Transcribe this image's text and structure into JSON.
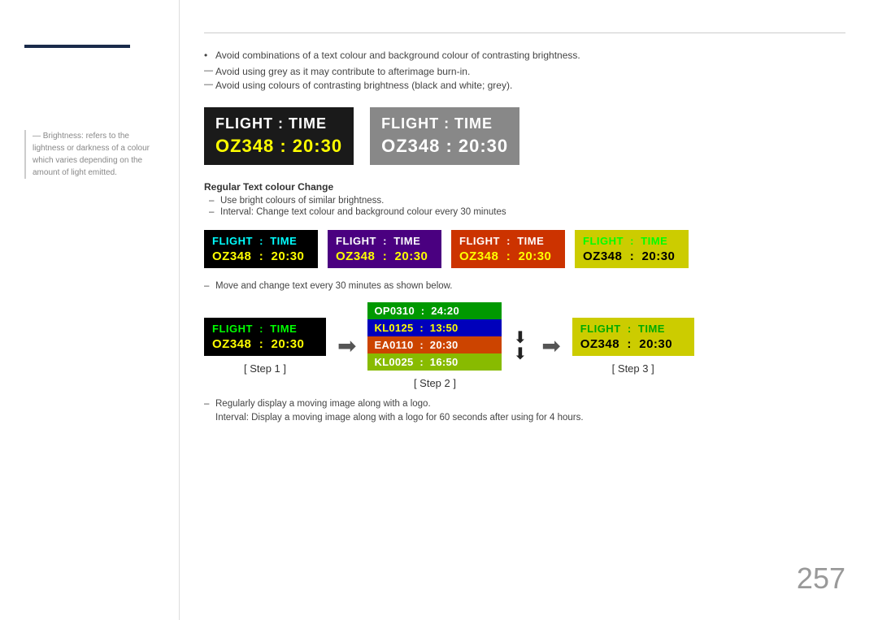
{
  "sidebar": {
    "note_label": "— Brightness: refers to the lightness or darkness of a colour which varies depending on the amount of light emitted."
  },
  "content": {
    "bullet1": "Avoid combinations of a text colour and background colour of contrasting brightness.",
    "dash1": "Avoid using grey as it may contribute to afterimage burn-in.",
    "dash2": "Avoid using colours of contrasting brightness (black and white; grey).",
    "main_box1": {
      "header": "FLIGHT  :  TIME",
      "data": "OZ348  :  20:30"
    },
    "main_box2": {
      "header": "FLIGHT  :  TIME",
      "data": "OZ348  :  20:30"
    },
    "section_title": "Regular Text colour Change",
    "sub1": "Use bright colours of similar brightness.",
    "sub2": "Interval: Change text colour and background colour every 30 minutes",
    "variants": [
      {
        "header": "FLIGHT  :  TIME",
        "data": "OZ348  :  20:30",
        "bg": "black",
        "hc": "cyan",
        "dc": "yellow"
      },
      {
        "header": "FLIGHT  :  TIME",
        "data": "OZ348  :  20:30",
        "bg": "purple",
        "hc": "white",
        "dc": "yellow"
      },
      {
        "header": "FLIGHT  :  TIME",
        "data": "OZ348  :  20:30",
        "bg": "orange-dark",
        "hc": "white",
        "dc": "yellow"
      },
      {
        "header": "FLIGHT  :  TIME",
        "data": "OZ348  :  20:30",
        "bg": "yellow-bg",
        "hc": "green",
        "dc": "black"
      }
    ],
    "steps_dash": "Move and change text every 30 minutes as shown below.",
    "step1": {
      "label": "[ Step 1 ]",
      "box": {
        "header": "FLIGHT  :  TIME",
        "data": "OZ348  :  20:30"
      }
    },
    "step2": {
      "label": "[ Step 2 ]",
      "rows": [
        {
          "code": "OP0310",
          "time": "24:20",
          "bg": "green-bg",
          "tc": "white"
        },
        {
          "code": "KL0125",
          "time": "13:50",
          "bg": "blue-bg",
          "tc": "yellow"
        },
        {
          "code": "EA0110",
          "time": "20:30",
          "bg": "orange-bg",
          "tc": "white"
        },
        {
          "code": "KL0025",
          "time": "16:50",
          "bg": "green-bg2",
          "tc": "white"
        }
      ]
    },
    "step3": {
      "label": "[ Step 3 ]",
      "box": {
        "header": "FLIGHT  :  TIME",
        "data": "OZ348  :  20:30"
      }
    },
    "bottom_note1": "Regularly display a moving image along with a logo.",
    "bottom_note2": "Interval: Display a moving image along with a logo for 60 seconds after using for 4 hours.",
    "page_number": "257"
  }
}
